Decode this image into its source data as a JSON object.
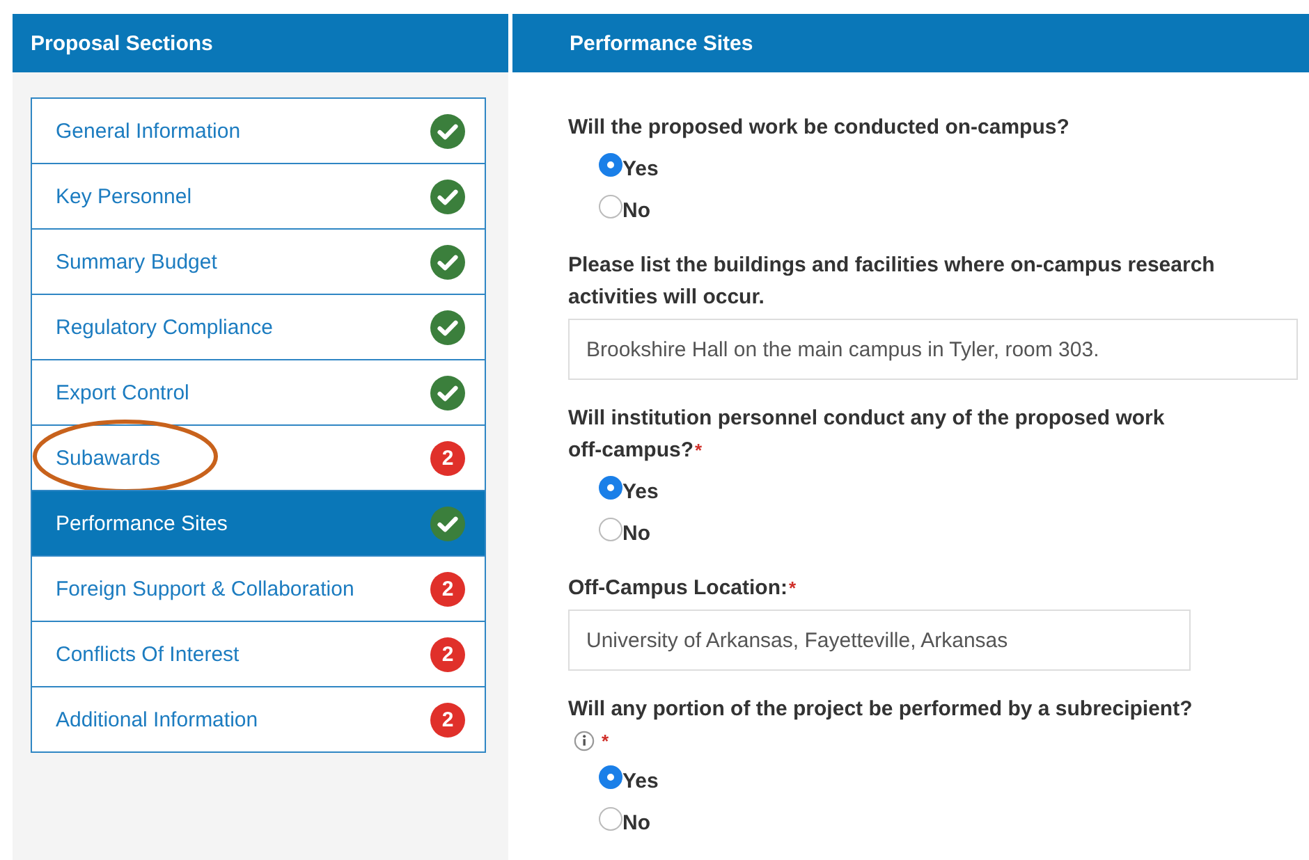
{
  "sidebar": {
    "title": "Proposal Sections",
    "items": [
      {
        "label": "General Information",
        "kind": "check",
        "selected": false,
        "circled": false
      },
      {
        "label": "Key Personnel",
        "kind": "check",
        "selected": false,
        "circled": false
      },
      {
        "label": "Summary Budget",
        "kind": "check",
        "selected": false,
        "circled": false
      },
      {
        "label": "Regulatory Compliance",
        "kind": "check",
        "selected": false,
        "circled": false
      },
      {
        "label": "Export Control",
        "kind": "check",
        "selected": false,
        "circled": false
      },
      {
        "label": "Subawards",
        "kind": "count",
        "count": "2",
        "selected": false,
        "circled": true
      },
      {
        "label": "Performance Sites",
        "kind": "check",
        "selected": true,
        "circled": false
      },
      {
        "label": "Foreign Support & Collaboration",
        "kind": "count",
        "count": "2",
        "selected": false,
        "circled": false
      },
      {
        "label": "Conflicts Of Interest",
        "kind": "count",
        "count": "2",
        "selected": false,
        "circled": false
      },
      {
        "label": "Additional Information",
        "kind": "count",
        "count": "2",
        "selected": false,
        "circled": false
      }
    ]
  },
  "main": {
    "title": "Performance Sites",
    "questions": [
      {
        "kind": "radio",
        "label": "Will the proposed work be conducted on-campus?",
        "info": false,
        "options": [
          {
            "label": "Yes",
            "selected": true
          },
          {
            "label": "No",
            "selected": false
          }
        ]
      },
      {
        "kind": "long_text",
        "label": "Please list the buildings and facilities where on-campus research activities will occur.",
        "info": false,
        "value": "Brookshire Hall on the main campus in Tyler, room 303."
      },
      {
        "kind": "radio",
        "label": "Will institution personnel conduct any of the proposed work off-campus?",
        "required_marker": "*",
        "info": false,
        "options": [
          {
            "label": "Yes",
            "selected": true
          },
          {
            "label": "No",
            "selected": false
          }
        ]
      },
      {
        "kind": "short_text",
        "label": "Off-Campus Location:",
        "required_marker": "*",
        "info": false,
        "value": "University of Arkansas, Fayetteville, Arkansas"
      },
      {
        "kind": "radio",
        "label": "Will any portion of the project be performed by a subrecipient?",
        "required_marker": "*",
        "info": true,
        "options": [
          {
            "label": "Yes",
            "selected": true
          },
          {
            "label": "No",
            "selected": false
          }
        ]
      }
    ]
  }
}
